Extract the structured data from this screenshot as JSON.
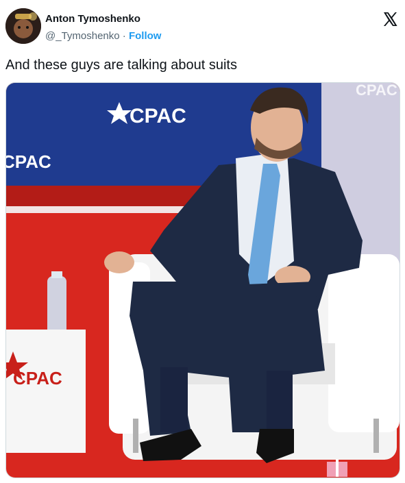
{
  "author": {
    "display_name": "Anton Tymoshenko",
    "handle": "@_Tymoshenko",
    "separator": "·",
    "follow_label": "Follow"
  },
  "tweet": {
    "text": "And these guys are talking about suits"
  },
  "media": {
    "brand_texts": [
      "CPAC",
      "CPAC",
      "CPAC",
      "CPAC"
    ]
  },
  "icons": {
    "platform": "x-logo-icon"
  },
  "colors": {
    "follow": "#1d9bf0",
    "stage_red": "#d8271f",
    "backdrop_blue": "#1f3b8f",
    "suit_navy": "#1e2a44",
    "tie_blue": "#6aa6dc"
  }
}
